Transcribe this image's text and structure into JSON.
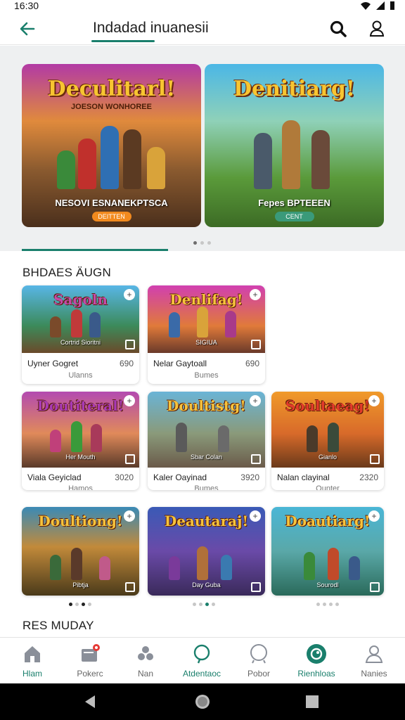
{
  "status": {
    "time": "16:30"
  },
  "app_bar": {
    "title": "Indadad inuanesii"
  },
  "hero": {
    "cards": [
      {
        "logo": "Deculitarl!",
        "subtitle": "JOESON WONHOREE",
        "caption": "NESOVI ESNANEKPTSCA",
        "button": "DEITTEN",
        "button_color": "#f28a1e"
      },
      {
        "logo": "Denitiarg!",
        "subtitle": "",
        "caption": "Fepes BPTEEEN",
        "button": "CENT",
        "button_color": "#3a9a7a"
      }
    ]
  },
  "section1": {
    "title": "BHDAES ÄUGN"
  },
  "section2": {
    "title": "RES MUDAY"
  },
  "games_row1": [
    {
      "logo": "Sagoln",
      "tag": "Cortrid Sioritni",
      "title": "Uyner Gogret",
      "num": "690",
      "sub": "Ulanns"
    },
    {
      "logo": "Denlifag!",
      "tag": "SIGIUA",
      "title": "Nelar Gaytoall",
      "num": "690",
      "sub": "Bumes"
    }
  ],
  "games_row2": [
    {
      "logo": "Doutiteral!",
      "tag": "Her Mouth",
      "title": "Viala Geyiclad",
      "num": "3020",
      "sub": "Hamos"
    },
    {
      "logo": "Doultistg!",
      "tag": "Sbar Colan",
      "title": "Kaler Oayinad",
      "num": "3920",
      "sub": "Bumes"
    },
    {
      "logo": "Soultaeag!",
      "tag": "Gianlo",
      "title": "Nalan clayinal",
      "num": "2320",
      "sub": "Ounter"
    }
  ],
  "games_row3": [
    {
      "logo": "Doultiong!",
      "tag": "Pibtja"
    },
    {
      "logo": "Deautaraj!",
      "tag": "Day Guba"
    },
    {
      "logo": "Doautiarg!",
      "tag": "Sourodl"
    }
  ],
  "bottom_nav": [
    {
      "label": "Hlam",
      "icon": "home-icon"
    },
    {
      "label": "Pokerc",
      "icon": "mail-icon"
    },
    {
      "label": "Nan",
      "icon": "apps-icon"
    },
    {
      "label": "Atdentaoc",
      "icon": "chat-icon"
    },
    {
      "label": "Pobor",
      "icon": "circle-icon"
    },
    {
      "label": "Rienhloas",
      "icon": "rewards-icon"
    },
    {
      "label": "Nanies",
      "icon": "person-icon"
    }
  ],
  "colors": {
    "accent": "#1a7f6c",
    "badge": "#e53935"
  }
}
